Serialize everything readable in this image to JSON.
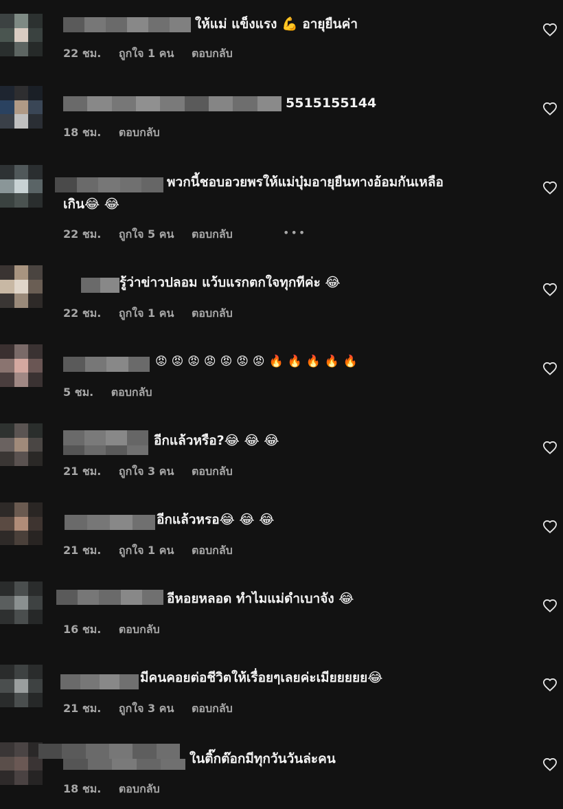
{
  "comments": [
    {
      "text": "ให้แม่ แข็งแรง 💪 อายุยืนค่า",
      "time": "22 ชม.",
      "likes": "ถูกใจ 1 คน",
      "reply": "ตอบกลับ"
    },
    {
      "text": "5515155144",
      "time": "18 ชม.",
      "likes": "",
      "reply": "ตอบกลับ"
    },
    {
      "text": "พวกนี้ชอบอวยพรให้แม่บุ๋มอายุยืนทางอ้อมกันเหลือ",
      "text2": "เกิน😂 😂",
      "time": "22 ชม.",
      "likes": "ถูกใจ 5 คน",
      "reply": "ตอบกลับ",
      "more": "•••"
    },
    {
      "text": "รู้ว่าข่าวปลอม แว้บแรกตกใจทุกทีค่ะ 😂",
      "time": "22 ชม.",
      "likes": "ถูกใจ 1 คน",
      "reply": "ตอบกลับ"
    },
    {
      "text": "😡 😡 😡 😡 😡 😡 😡 🔥 🔥 🔥  🔥 🔥",
      "time": "5 ชม.",
      "likes": "",
      "reply": "ตอบกลับ"
    },
    {
      "text": "อีกแล้วหรือ?😂 😂 😂",
      "time": "21 ชม.",
      "likes": "ถูกใจ 3 คน",
      "reply": "ตอบกลับ"
    },
    {
      "text": "อีกแล้วหรอ😂 😂 😂",
      "time": "21 ชม.",
      "likes": "ถูกใจ 1 คน",
      "reply": "ตอบกลับ"
    },
    {
      "text": "อีหอยหลอด ทำไมแม่ดำเบาจัง 😂",
      "time": "16 ชม.",
      "likes": "",
      "reply": "ตอบกลับ"
    },
    {
      "text": "มีคนคอยต่อชีวิตให้เรื่อยๆเลยค่ะเมียยยยย😂",
      "time": "21 ชม.",
      "likes": "ถูกใจ 3 คน",
      "reply": "ตอบกลับ"
    },
    {
      "text": "ในติ๊กต๊อกมีทุกวันวันล่ะคน",
      "time": "18 ชม.",
      "likes": "",
      "reply": "ตอบกลับ"
    }
  ],
  "colors": {
    "background": "#121212",
    "text": "#f3f3f3",
    "meta": "#a8a8a8",
    "heart": "#e8e8e8"
  },
  "icons": {
    "like": "heart-outline-icon",
    "more": "more-dots-icon"
  }
}
